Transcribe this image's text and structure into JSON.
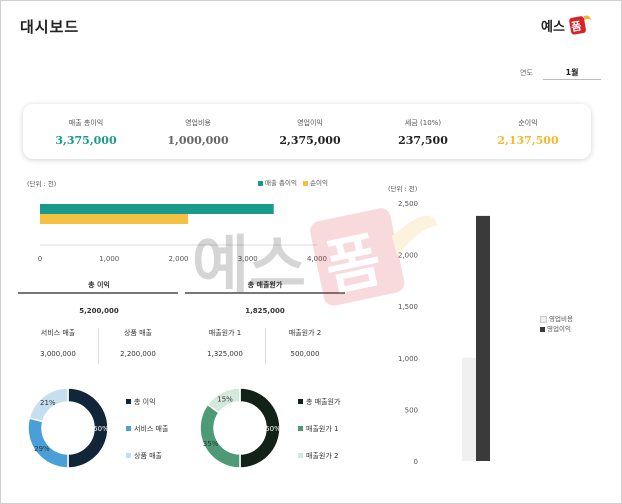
{
  "header": {
    "title": "대시보드",
    "logo_text": "예스폼"
  },
  "filter": {
    "year_label": "연도",
    "year_value": "1월"
  },
  "kpis": [
    {
      "label": "매출 총이익",
      "value": "3,375,000",
      "color": "#1a9a8a"
    },
    {
      "label": "영업비용",
      "value": "1,000,000",
      "color": "#666666"
    },
    {
      "label": "영업이익",
      "value": "2,375,000",
      "color": "#222222"
    },
    {
      "label": "세금 (10%)",
      "value": "237,500",
      "color": "#222222"
    },
    {
      "label": "순이익",
      "value": "2,137,500",
      "color": "#f5b930"
    }
  ],
  "watermark": "예스폼",
  "bar_chart_unit": "(단위 : 천)",
  "col_chart_unit": "(단위 : 천)",
  "summary": {
    "left_title": "총 이익",
    "left_value": "5,200,000",
    "right_title": "총 매출원가",
    "right_value": "1,825,000"
  },
  "details": [
    {
      "label": "서비스 매출",
      "value": "3,000,000"
    },
    {
      "label": "상품 매출",
      "value": "2,200,000"
    },
    {
      "label": "매출원가 1",
      "value": "1,325,000"
    },
    {
      "label": "매출원가 2",
      "value": "500,000"
    }
  ],
  "chart_data": [
    {
      "type": "bar",
      "orientation": "horizontal",
      "unit_label": "(단위 : 천)",
      "series": [
        {
          "name": "매출 총이익",
          "values": [
            3375
          ],
          "color": "#1a9a8a"
        },
        {
          "name": "순이익",
          "values": [
            2137.5
          ],
          "color": "#f5c143"
        }
      ],
      "xlim": [
        0,
        4000
      ],
      "xticks": [
        "0",
        "1,000",
        "2,000",
        "3,000",
        "4,000"
      ],
      "legend": "top"
    },
    {
      "type": "bar",
      "orientation": "vertical",
      "unit_label": "(단위 : 천)",
      "series": [
        {
          "name": "영업비용",
          "values": [
            1000
          ],
          "color": "#f0f0f0"
        },
        {
          "name": "영업이익",
          "values": [
            2375
          ],
          "color": "#3a3a3a"
        }
      ],
      "ylim": [
        0,
        2500
      ],
      "yticks": [
        "0",
        "500",
        "1,000",
        "1,500",
        "2,000",
        "2,500"
      ],
      "legend": "right"
    },
    {
      "type": "pie",
      "style": "donut",
      "slices": [
        {
          "name": "총 이익",
          "value": 50,
          "label": "50%",
          "color": "#12263a"
        },
        {
          "name": "서비스 매출",
          "value": 29,
          "label": "29%",
          "color": "#4a9fd8"
        },
        {
          "name": "상품 매출",
          "value": 21,
          "label": "21%",
          "color": "#c5dff0"
        }
      ],
      "legend": "right"
    },
    {
      "type": "pie",
      "style": "donut",
      "slices": [
        {
          "name": "총 매출원가",
          "value": 50,
          "label": "50%",
          "color": "#132218"
        },
        {
          "name": "매출원가 1",
          "value": 35,
          "label": "35%",
          "color": "#4e9a77"
        },
        {
          "name": "매출원가 2",
          "value": 15,
          "label": "15%",
          "color": "#d4e8dc"
        }
      ],
      "legend": "right"
    }
  ]
}
